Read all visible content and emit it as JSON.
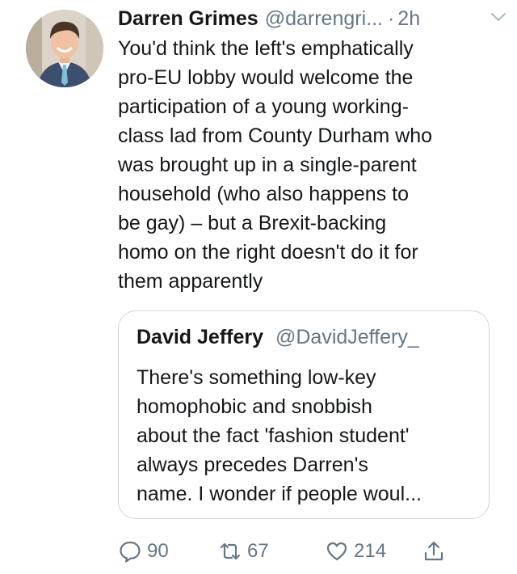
{
  "tweet": {
    "author": {
      "display_name": "Darren Grimes",
      "handle": "@darrengri...",
      "avatar_icon": "profile-photo"
    },
    "separator": "·",
    "time": "2h",
    "text": "You'd think the left's emphatically\npro-EU lobby would welcome the\nparticipation of a young working-\nclass lad from County Durham who\nwas brought up in a single-parent\nhousehold (who also happens to\nbe gay) – but a Brexit-backing\nhomo on the right doesn't do it for\nthem apparently",
    "quote": {
      "display_name": "David Jeffery",
      "handle": "@DavidJeffery_",
      "text": "There's something low-key\nhomophobic and snobbish\nabout the fact 'fashion student'\nalways precedes Darren's\nname. I wonder if people woul..."
    },
    "actions": {
      "replies": "90",
      "retweets": "67",
      "likes": "214"
    }
  },
  "colors": {
    "text": "#14171a",
    "secondary": "#657786",
    "border": "#ccd6dd",
    "background": "#ffffff"
  },
  "icons": {
    "caret": "chevron-down-icon",
    "reply": "reply-icon",
    "retweet": "retweet-icon",
    "like": "heart-icon",
    "share": "share-icon"
  }
}
